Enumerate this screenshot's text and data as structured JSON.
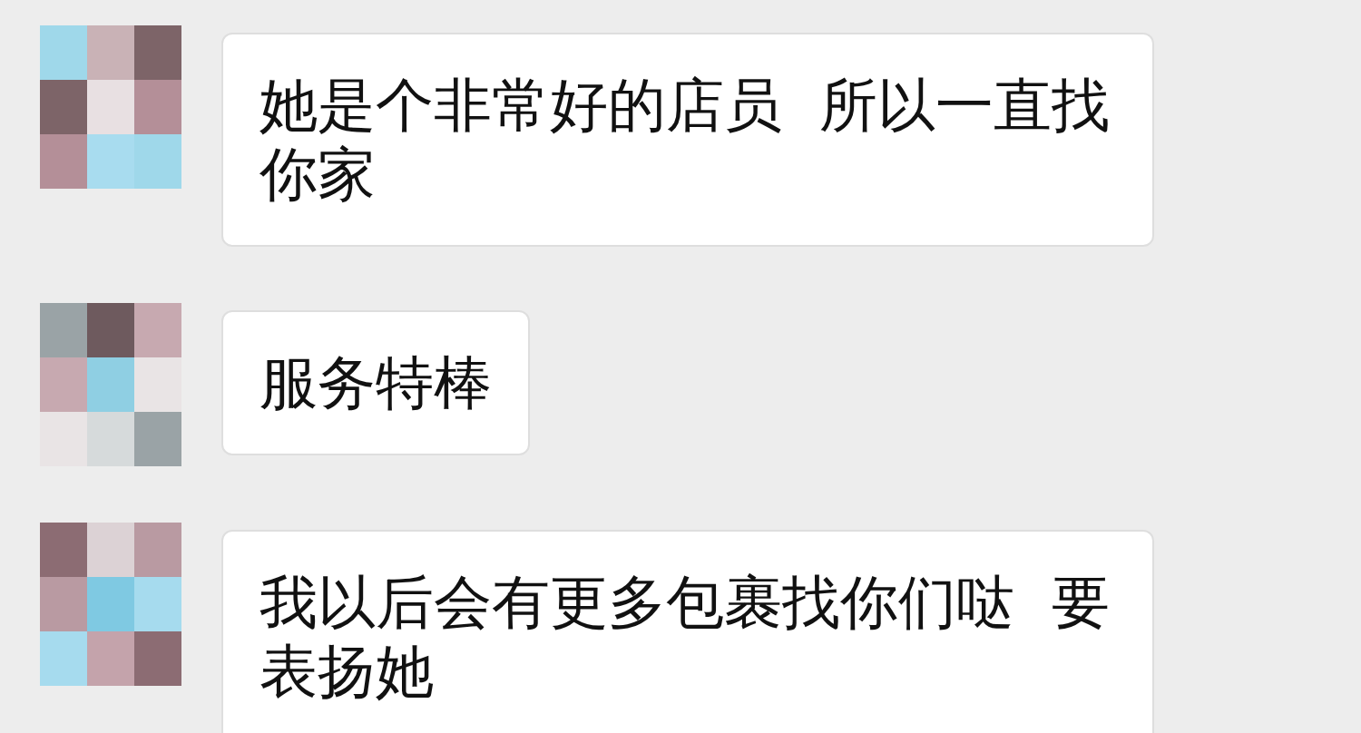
{
  "messages": [
    {
      "text": "她是个非常好的店员  所以一直找你家"
    },
    {
      "text": "服务特棒"
    },
    {
      "text": "我以后会有更多包裹找你们哒  要表扬她"
    }
  ]
}
